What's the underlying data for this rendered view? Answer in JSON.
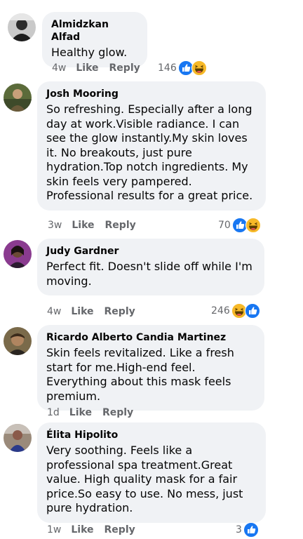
{
  "comments": [
    {
      "name": "Almidzkan Alfad",
      "text": "Healthy glow.",
      "time": "4w",
      "like": "Like",
      "reply": "Reply",
      "reaction_count": "146",
      "reactions": [
        "like-icon",
        "haha-icon"
      ]
    },
    {
      "name": "Josh Mooring",
      "text": "So refreshing. Especially after a long day at work.Visible radiance. I can see the glow instantly.My skin loves it. No breakouts, just pure hydration.Top notch ingredients. My skin feels very pampered. Professional results for a great price.",
      "time": "3w",
      "like": "Like",
      "reply": "Reply",
      "reaction_count": "70",
      "reactions": [
        "like-icon",
        "haha-icon"
      ]
    },
    {
      "name": "Judy Gardner",
      "text": "Perfect fit. Doesn't slide off while I'm moving.",
      "time": "4w",
      "like": "Like",
      "reply": "Reply",
      "reaction_count": "246",
      "reactions": [
        "haha-icon",
        "like-icon"
      ]
    },
    {
      "name": "Ricardo Alberto Candia Martinez",
      "text": "Skin feels revitalized. Like a fresh start for me.High-end feel. Everything about this mask feels premium.",
      "time": "1d",
      "like": "Like",
      "reply": "Reply",
      "reaction_count": "",
      "reactions": []
    },
    {
      "name": "Élita Hipolito",
      "text": "Very soothing. Feels like a professional spa treatment.Great value. High quality mask for a fair price.So easy to use. No mess, just pure hydration.",
      "time": "1w",
      "like": "Like",
      "reply": "Reply",
      "reaction_count": "3",
      "reactions": [
        "like-icon"
      ]
    }
  ],
  "colors": {
    "bubble": "#f0f2f5",
    "meta": "#65676b",
    "like_blue": "#1877f2",
    "haha_yellow": "#f7b928"
  }
}
